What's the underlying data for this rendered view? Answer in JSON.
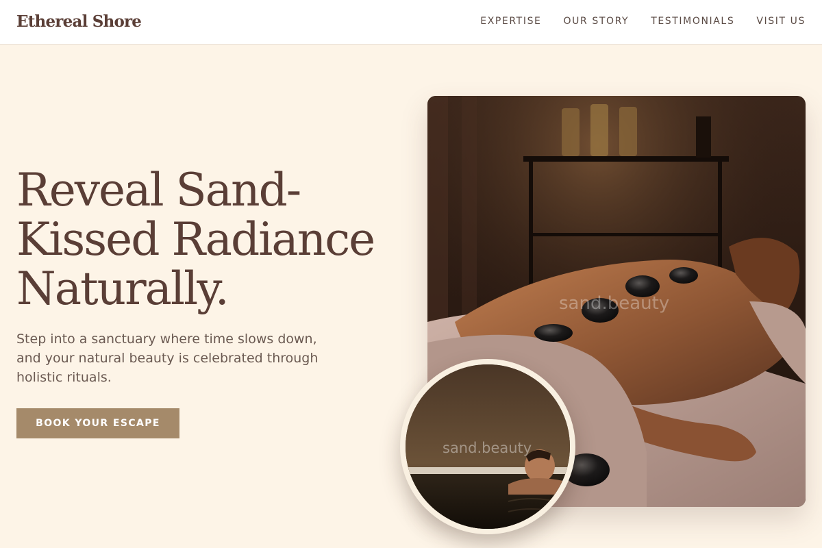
{
  "brand": {
    "name": "Ethereal Shore"
  },
  "nav": {
    "items": [
      {
        "label": "EXPERTISE"
      },
      {
        "label": "OUR STORY"
      },
      {
        "label": "TESTIMONIALS"
      },
      {
        "label": "VISIT US"
      }
    ]
  },
  "hero": {
    "title_line1": "Reveal Sand-",
    "title_line2": "Kissed Radiance",
    "title_line3": "Naturally.",
    "subtitle": "Step into a sanctuary where time slows down, and your natural beauty is celebrated through holistic rituals.",
    "cta_label": "BOOK YOUR ESCAPE"
  },
  "images": {
    "main_watermark": "sand.beauty",
    "circle_watermark": "sand.beauty"
  },
  "colors": {
    "background": "#fdf4e7",
    "header_bg": "#ffffff",
    "text_primary": "#5a3e36",
    "accent": "#a58a6a"
  }
}
